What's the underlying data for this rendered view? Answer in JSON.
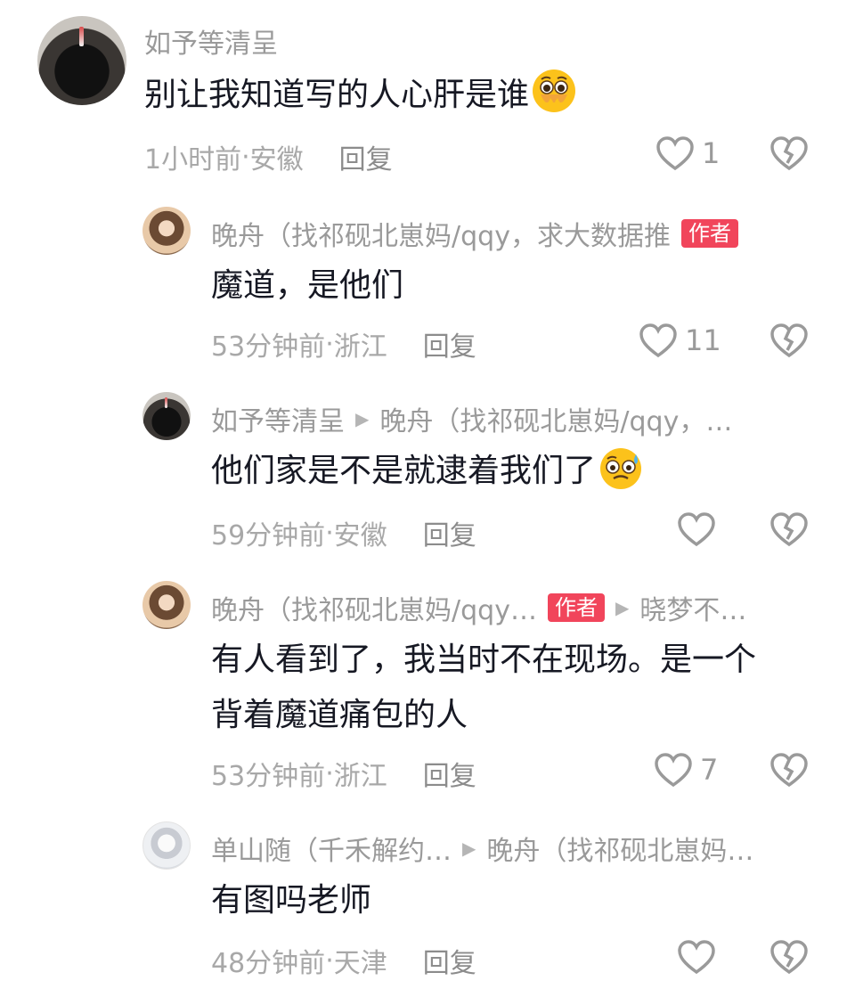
{
  "comments": [
    {
      "user": "如予等清呈",
      "text": "别让我知道写的人心肝是谁",
      "emoji": "pleading-face-emoji",
      "time": "1小时前",
      "location": "安徽",
      "reply": "回复",
      "likes": "1"
    },
    {
      "user": "晚舟（找祁砚北崽妈/qqy，求大数据推",
      "author_tag": "作者",
      "text": "魔道，是他们",
      "time": "53分钟前",
      "location": "浙江",
      "reply": "回复",
      "likes": "11"
    },
    {
      "user": "如予等清呈",
      "reply_to": "晚舟（找祁砚北崽妈/qqy，…",
      "text": "他们家是不是就逮着我们了",
      "emoji": "anxious-sweat-face-emoji",
      "time": "59分钟前",
      "location": "安徽",
      "reply": "回复",
      "likes": ""
    },
    {
      "user": "晚舟（找祁砚北崽妈/qqy…",
      "author_tag": "作者",
      "reply_to": "晓梦不…",
      "text_line1": "有人看到了，我当时不在现场。是一个",
      "text_line2": "背着魔道痛包的人",
      "time": "53分钟前",
      "location": "浙江",
      "reply": "回复",
      "likes": "7"
    },
    {
      "user": "单山随（千禾解约…",
      "reply_to": "晚舟（找祁砚北崽妈…",
      "text": "有图吗老师",
      "time": "48分钟前",
      "location": "天津",
      "reply": "回复",
      "likes": ""
    }
  ],
  "meta_separator": " · ",
  "colors": {
    "author_tag_bg": "#f1455b",
    "name_text": "#9a9a9a",
    "body_text": "#161823",
    "meta_text": "#a8a8a8"
  }
}
